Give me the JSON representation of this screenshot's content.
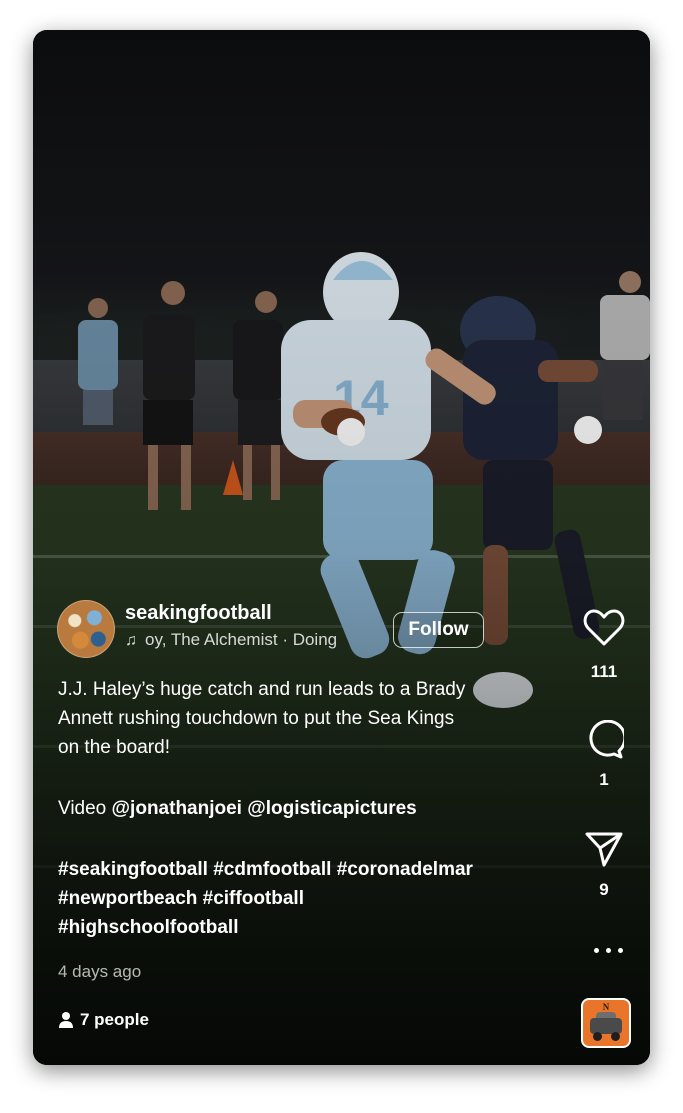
{
  "post": {
    "username": "seakingfootball",
    "music_text": "oy, The Alchemist · Doing",
    "follow_label": "Follow",
    "caption_lines": [
      "J.J. Haley’s huge catch and run leads to a Brady",
      "Annett rushing touchdown to put the Sea Kings",
      "on the board!"
    ],
    "video_prefix": "Video ",
    "video_credits": "@jonathanjoei @logisticapictures",
    "hashtag_lines": [
      "#seakingfootball #cdmfootball #coronadelmar",
      "#newportbeach #ciffootball",
      "#highschoolfootball"
    ],
    "time_ago": "4 days ago",
    "people_label": "7 people"
  },
  "actions": {
    "likes": "111",
    "comments": "1",
    "shares": "9"
  },
  "icons": {
    "like": "heart-icon",
    "comment": "comment-bubble-icon",
    "share": "paper-plane-icon",
    "more": "more-horizontal-icon",
    "music": "music-note-icon",
    "people": "person-icon"
  },
  "colors": {
    "text": "#ffffff",
    "audio_thumb": "#e9752a"
  }
}
